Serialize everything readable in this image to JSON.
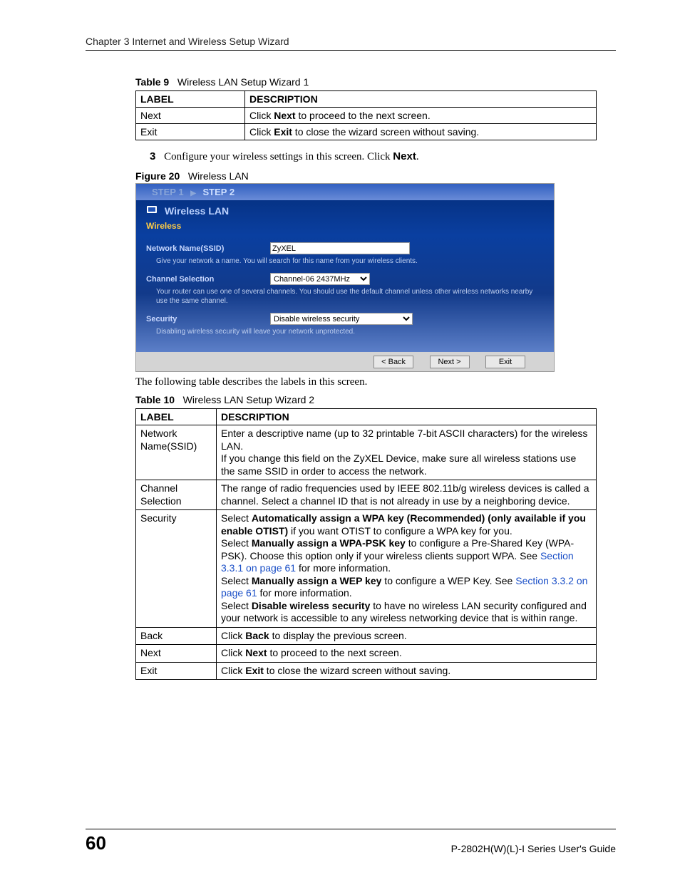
{
  "header": {
    "chapter": "Chapter 3 Internet and Wireless Setup Wizard"
  },
  "table9": {
    "caption_bold": "Table 9",
    "caption_rest": "Wireless LAN Setup Wizard 1",
    "head_label": "LABEL",
    "head_desc": "DESCRIPTION",
    "rows": [
      {
        "label": "Next",
        "pre": "Click ",
        "bold": "Next",
        "post": " to proceed to the next screen."
      },
      {
        "label": "Exit",
        "pre": "Click ",
        "bold": "Exit",
        "post": " to close the wizard screen without saving."
      }
    ]
  },
  "step3": {
    "num": "3",
    "text_a": "Configure your wireless settings in this screen. Click ",
    "text_bold": "Next",
    "text_b": "."
  },
  "figure20": {
    "caption_bold": "Figure 20",
    "caption_rest": "Wireless LAN",
    "steps": {
      "s1": "STEP 1",
      "s2": "STEP 2"
    },
    "title": "Wireless LAN",
    "section": "Wireless",
    "ssid_label": "Network Name(SSID)",
    "ssid_value": "ZyXEL",
    "ssid_help": "Give your network a name. You will search for this name from your wireless clients.",
    "channel_label": "Channel Selection",
    "channel_value": "Channel-06 2437MHz",
    "channel_help": "Your router can use one of several channels. You should use the default channel unless other wireless networks nearby use the same channel.",
    "security_label": "Security",
    "security_value": "Disable wireless security",
    "security_help": "Disabling wireless security will leave your network unprotected.",
    "btn_back": "< Back",
    "btn_next": "Next >",
    "btn_exit": "Exit"
  },
  "para_after_figure": "The following table describes the labels in this screen.",
  "table10": {
    "caption_bold": "Table 10",
    "caption_rest": "Wireless LAN Setup Wizard 2",
    "head_label": "LABEL",
    "head_desc": "DESCRIPTION",
    "rows": {
      "ssid": {
        "label": "Network Name(SSID)",
        "p1": "Enter a descriptive name (up to 32 printable 7-bit ASCII characters) for the wireless LAN.",
        "p2": "If you change this field on the ZyXEL Device, make sure all wireless stations use the same SSID in order to access the network."
      },
      "channel": {
        "label": "Channel Selection",
        "p1": "The range of radio frequencies used by IEEE 802.11b/g wireless devices is called a channel. Select a channel ID that is not already in use by a neighboring device."
      },
      "security": {
        "label": "Security",
        "l1_pre": "Select ",
        "l1_bold": "Automatically assign a WPA key (Recommended) (only available if you enable OTIST)",
        "l1_post": " if you want OTIST to configure a WPA key for you.",
        "l2_pre": "Select ",
        "l2_bold": "Manually assign a WPA-PSK key",
        "l2_mid": " to configure a Pre-Shared Key (WPA-PSK). Choose this option only if your wireless clients support WPA. See ",
        "l2_link": "Section 3.3.1 on page 61",
        "l2_post": " for more information.",
        "l3_pre": "Select ",
        "l3_bold": "Manually assign a WEP key",
        "l3_mid": " to configure a WEP Key. See ",
        "l3_link": "Section 3.3.2 on page 61",
        "l3_post": " for more information.",
        "l4_pre": "Select ",
        "l4_bold": "Disable wireless security",
        "l4_post": " to have no wireless LAN security configured and your network is accessible to any wireless networking device that is within range."
      },
      "back": {
        "label": "Back",
        "pre": "Click ",
        "bold": "Back",
        "post": " to display the previous screen."
      },
      "next": {
        "label": "Next",
        "pre": "Click ",
        "bold": "Next",
        "post": " to proceed to the next screen."
      },
      "exit": {
        "label": "Exit",
        "pre": "Click ",
        "bold": "Exit",
        "post": " to close the wizard screen without saving."
      }
    }
  },
  "footer": {
    "page": "60",
    "guide": "P-2802H(W)(L)-I Series User's Guide"
  }
}
